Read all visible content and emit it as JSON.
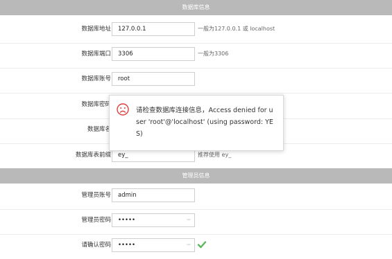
{
  "db_section": {
    "title": "数据库信息"
  },
  "admin_section": {
    "title": "管理员信息"
  },
  "db_fields": [
    {
      "label": "数据库地址",
      "value": "127.0.0.1",
      "hint": "一般为127.0.0.1 或 localhost"
    },
    {
      "label": "数据库端口",
      "value": "3306",
      "hint": "一般为3306"
    },
    {
      "label": "数据库账号",
      "value": "root"
    },
    {
      "label": "数据库密码",
      "value": ""
    },
    {
      "label": "数据库名",
      "value": ""
    },
    {
      "label": "数据库表前缀",
      "value": "ey_",
      "hint": "推荐使用 ey_"
    }
  ],
  "admin_fields": [
    {
      "label": "管理员账号",
      "value": "admin"
    },
    {
      "label": "管理员密码",
      "value": "•••••",
      "eye": "ᵕ·ᵕ"
    },
    {
      "label": "请确认密码",
      "value": "•••••",
      "eye": "ᵕ·ᵕ"
    }
  ],
  "error_modal": {
    "icon": "sad-face-icon",
    "message": "请检查数据库连接信息，Access denied for user 'root'@'localhost' (using password: YES)"
  },
  "colors": {
    "header_bg": "#b9b9b9",
    "error_red": "#e23d3d",
    "check_green": "#5cb85c"
  }
}
